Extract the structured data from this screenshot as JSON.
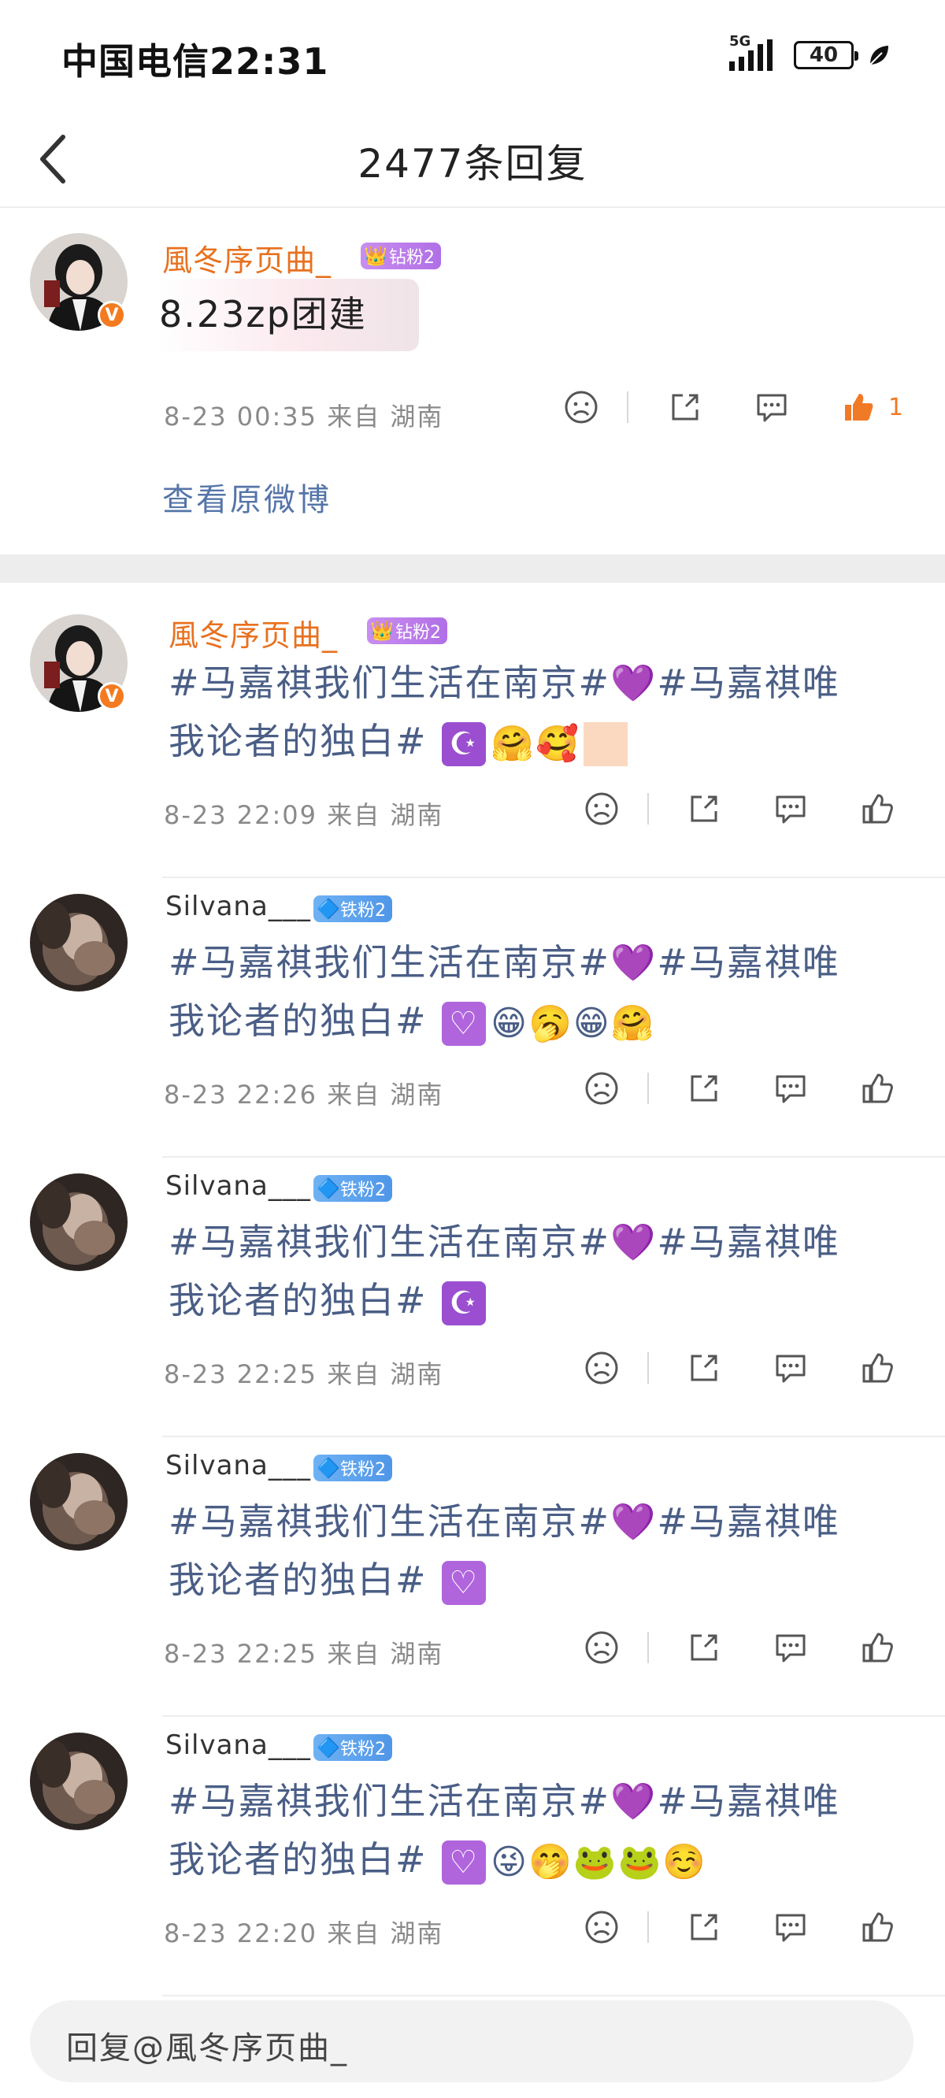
{
  "status_bar": {
    "carrier_time": "中国电信22:31",
    "network": "5G",
    "battery": "40"
  },
  "nav": {
    "title": "2477条回复",
    "back_icon": "chevron-left-icon"
  },
  "original": {
    "username": "風冬序页曲_",
    "badge": "钻粉2",
    "text": "8.23zp团建",
    "meta": "8-23 00:35  来自 湖南",
    "like_count": "1",
    "view_original": "查看原微博"
  },
  "replies": [
    {
      "username": "風冬序页曲_",
      "badge": "钻粉2",
      "line1": "#马嘉祺我们生活在南京#",
      "line1_tail": "#马嘉祺唯",
      "line2": "我论者的独白#",
      "emojis": "🤗🥰",
      "meta": "8-23 22:09  来自 湖南"
    },
    {
      "username": "Silvana___",
      "badge": "铁粉2",
      "line1": "#马嘉祺我们生活在南京#",
      "line1_tail": "#马嘉祺唯",
      "line2": "我论者的独白#",
      "emojis": "😁🥱😁🤗",
      "meta": "8-23 22:26  来自 湖南"
    },
    {
      "username": "Silvana___",
      "badge": "铁粉2",
      "line1": "#马嘉祺我们生活在南京#",
      "line1_tail": "#马嘉祺唯",
      "line2": "我论者的独白#",
      "emojis": "",
      "meta": "8-23 22:25  来自 湖南"
    },
    {
      "username": "Silvana___",
      "badge": "铁粉2",
      "line1": "#马嘉祺我们生活在南京#",
      "line1_tail": "#马嘉祺唯",
      "line2": "我论者的独白#",
      "emojis": "",
      "meta": "8-23 22:25  来自 湖南"
    },
    {
      "username": "Silvana___",
      "badge": "铁粉2",
      "line1": "#马嘉祺我们生活在南京#",
      "line1_tail": "#马嘉祺唯",
      "line2": "我论者的独白#",
      "emojis": "😜🤭🐸🐸☺️",
      "meta": "8-23 22:20  来自 湖南"
    }
  ],
  "reply_input": {
    "placeholder": "回复@風冬序页曲_"
  },
  "colors": {
    "username_orange": "#e8711f",
    "topic_blue": "#4a5e86",
    "like_orange": "#f07a26",
    "meta_gray": "#8a8a8a"
  }
}
